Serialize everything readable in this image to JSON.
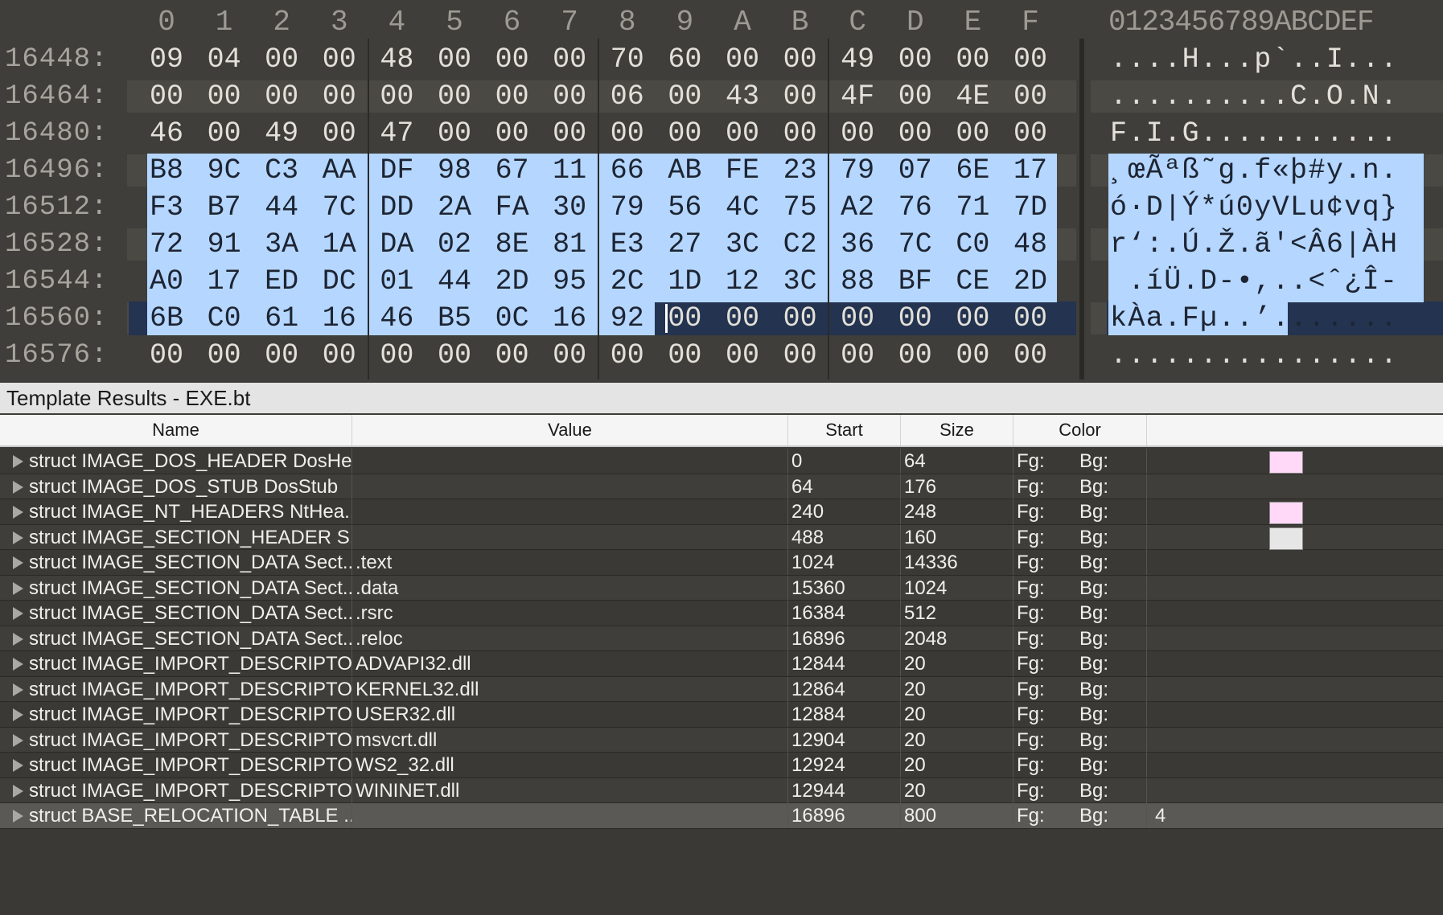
{
  "hex_editor": {
    "column_headers": [
      "0",
      "1",
      "2",
      "3",
      "4",
      "5",
      "6",
      "7",
      "8",
      "9",
      "A",
      "B",
      "C",
      "D",
      "E",
      "F"
    ],
    "ascii_header": "0123456789ABCDEF",
    "rows": [
      {
        "address": "16448:",
        "bytes": [
          "09",
          "04",
          "00",
          "00",
          "48",
          "00",
          "00",
          "00",
          "70",
          "60",
          "00",
          "00",
          "49",
          "00",
          "00",
          "00"
        ],
        "ascii": "....H...p`..I..."
      },
      {
        "address": "16464:",
        "bytes": [
          "00",
          "00",
          "00",
          "00",
          "00",
          "00",
          "00",
          "00",
          "06",
          "00",
          "43",
          "00",
          "4F",
          "00",
          "4E",
          "00"
        ],
        "ascii": "..........C.O.N."
      },
      {
        "address": "16480:",
        "bytes": [
          "46",
          "00",
          "49",
          "00",
          "47",
          "00",
          "00",
          "00",
          "00",
          "00",
          "00",
          "00",
          "00",
          "00",
          "00",
          "00"
        ],
        "ascii": "F.I.G..........."
      },
      {
        "address": "16496:",
        "bytes": [
          "B8",
          "9C",
          "C3",
          "AA",
          "DF",
          "98",
          "67",
          "11",
          "66",
          "AB",
          "FE",
          "23",
          "79",
          "07",
          "6E",
          "17"
        ],
        "ascii": "¸œÃªß˜g.f«þ#y.n."
      },
      {
        "address": "16512:",
        "bytes": [
          "F3",
          "B7",
          "44",
          "7C",
          "DD",
          "2A",
          "FA",
          "30",
          "79",
          "56",
          "4C",
          "75",
          "A2",
          "76",
          "71",
          "7D"
        ],
        "ascii": "ó·D|Ý*ú0yVLu¢vq}"
      },
      {
        "address": "16528:",
        "bytes": [
          "72",
          "91",
          "3A",
          "1A",
          "DA",
          "02",
          "8E",
          "81",
          "E3",
          "27",
          "3C",
          "C2",
          "36",
          "7C",
          "C0",
          "48"
        ],
        "ascii": "r‘:.Ú.Ž.ã'<Â6|ÀH"
      },
      {
        "address": "16544:",
        "bytes": [
          "A0",
          "17",
          "ED",
          "DC",
          "01",
          "44",
          "2D",
          "95",
          "2C",
          "1D",
          "12",
          "3C",
          "88",
          "BF",
          "CE",
          "2D"
        ],
        "ascii": " .íÜ.D-•,..<ˆ¿Î-"
      },
      {
        "address": "16560:",
        "bytes": [
          "6B",
          "C0",
          "61",
          "16",
          "46",
          "B5",
          "0C",
          "16",
          "92",
          "00",
          "00",
          "00",
          "00",
          "00",
          "00",
          "00"
        ],
        "ascii": "kÀa.Fµ..’......."
      },
      {
        "address": "16576:",
        "bytes": [
          "00",
          "00",
          "00",
          "00",
          "00",
          "00",
          "00",
          "00",
          "00",
          "00",
          "00",
          "00",
          "00",
          "00",
          "00",
          "00"
        ],
        "ascii": "................"
      }
    ],
    "selection_color": "#b4d6ff",
    "selection_start": {
      "row": 3,
      "col": 0
    },
    "selection_end": {
      "row": 7,
      "col": 8
    }
  },
  "template_results": {
    "title": "Template Results - EXE.bt",
    "columns": [
      "Name",
      "Value",
      "Start",
      "Size",
      "Color"
    ],
    "rows": [
      {
        "name": "struct IMAGE_DOS_HEADER DosHe...",
        "value": "",
        "start": "0",
        "size": "64",
        "fg": "Fg:",
        "bg": "Bg:",
        "bg_swatch": "#ffd9f7",
        "extra": ""
      },
      {
        "name": "struct IMAGE_DOS_STUB DosStub",
        "value": "",
        "start": "64",
        "size": "176",
        "fg": "Fg:",
        "bg": "Bg:",
        "bg_swatch": "",
        "extra": ""
      },
      {
        "name": "struct IMAGE_NT_HEADERS NtHea...",
        "value": "",
        "start": "240",
        "size": "248",
        "fg": "Fg:",
        "bg": "Bg:",
        "bg_swatch": "#ffd9f7",
        "extra": ""
      },
      {
        "name": "struct IMAGE_SECTION_HEADER S...",
        "value": "",
        "start": "488",
        "size": "160",
        "fg": "Fg:",
        "bg": "Bg:",
        "bg_swatch": "#e6e6e6",
        "extra": ""
      },
      {
        "name": "struct IMAGE_SECTION_DATA Sect...",
        "value": ".text",
        "start": "1024",
        "size": "14336",
        "fg": "Fg:",
        "bg": "Bg:",
        "bg_swatch": "",
        "extra": ""
      },
      {
        "name": "struct IMAGE_SECTION_DATA Sect...",
        "value": ".data",
        "start": "15360",
        "size": "1024",
        "fg": "Fg:",
        "bg": "Bg:",
        "bg_swatch": "",
        "extra": ""
      },
      {
        "name": "struct IMAGE_SECTION_DATA Sect...",
        "value": ".rsrc",
        "start": "16384",
        "size": "512",
        "fg": "Fg:",
        "bg": "Bg:",
        "bg_swatch": "",
        "extra": ""
      },
      {
        "name": "struct IMAGE_SECTION_DATA Sect...",
        "value": ".reloc",
        "start": "16896",
        "size": "2048",
        "fg": "Fg:",
        "bg": "Bg:",
        "bg_swatch": "",
        "extra": ""
      },
      {
        "name": "struct IMAGE_IMPORT_DESCRIPTO...",
        "value": "ADVAPI32.dll",
        "start": "12844",
        "size": "20",
        "fg": "Fg:",
        "bg": "Bg:",
        "bg_swatch": "",
        "extra": ""
      },
      {
        "name": "struct IMAGE_IMPORT_DESCRIPTO...",
        "value": "KERNEL32.dll",
        "start": "12864",
        "size": "20",
        "fg": "Fg:",
        "bg": "Bg:",
        "bg_swatch": "",
        "extra": ""
      },
      {
        "name": "struct IMAGE_IMPORT_DESCRIPTO...",
        "value": "USER32.dll",
        "start": "12884",
        "size": "20",
        "fg": "Fg:",
        "bg": "Bg:",
        "bg_swatch": "",
        "extra": ""
      },
      {
        "name": "struct IMAGE_IMPORT_DESCRIPTO...",
        "value": "msvcrt.dll",
        "start": "12904",
        "size": "20",
        "fg": "Fg:",
        "bg": "Bg:",
        "bg_swatch": "",
        "extra": ""
      },
      {
        "name": "struct IMAGE_IMPORT_DESCRIPTO...",
        "value": "WS2_32.dll",
        "start": "12924",
        "size": "20",
        "fg": "Fg:",
        "bg": "Bg:",
        "bg_swatch": "",
        "extra": ""
      },
      {
        "name": "struct IMAGE_IMPORT_DESCRIPTO...",
        "value": "WININET.dll",
        "start": "12944",
        "size": "20",
        "fg": "Fg:",
        "bg": "Bg:",
        "bg_swatch": "",
        "extra": ""
      },
      {
        "name": "struct BASE_RELOCATION_TABLE ...",
        "value": "",
        "start": "16896",
        "size": "800",
        "fg": "Fg:",
        "bg": "Bg:",
        "bg_swatch": "",
        "extra": "4",
        "selected": true
      }
    ]
  }
}
